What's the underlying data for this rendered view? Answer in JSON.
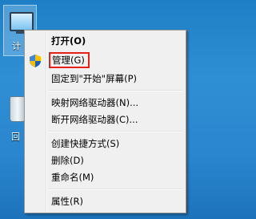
{
  "desktop": {
    "icons": [
      {
        "name": "computer",
        "label": "计"
      },
      {
        "name": "recycle-bin",
        "label": "回"
      }
    ]
  },
  "context_menu": {
    "items": [
      {
        "label": "打开(O)",
        "bold": true
      },
      {
        "label": "管理(G)",
        "icon": "shield-icon",
        "highlighted": true
      },
      {
        "label": "固定到\"开始\"屏幕(P)"
      },
      {
        "label": "映射网络驱动器(N)..."
      },
      {
        "label": "断开网络驱动器(C)..."
      },
      {
        "label": "创建快捷方式(S)"
      },
      {
        "label": "删除(D)"
      },
      {
        "label": "重命名(M)"
      },
      {
        "label": "属性(R)"
      }
    ]
  },
  "colors": {
    "desktop_background": "#2a86cf",
    "menu_background": "#f0f0f0",
    "highlight_border": "#e8201a"
  }
}
